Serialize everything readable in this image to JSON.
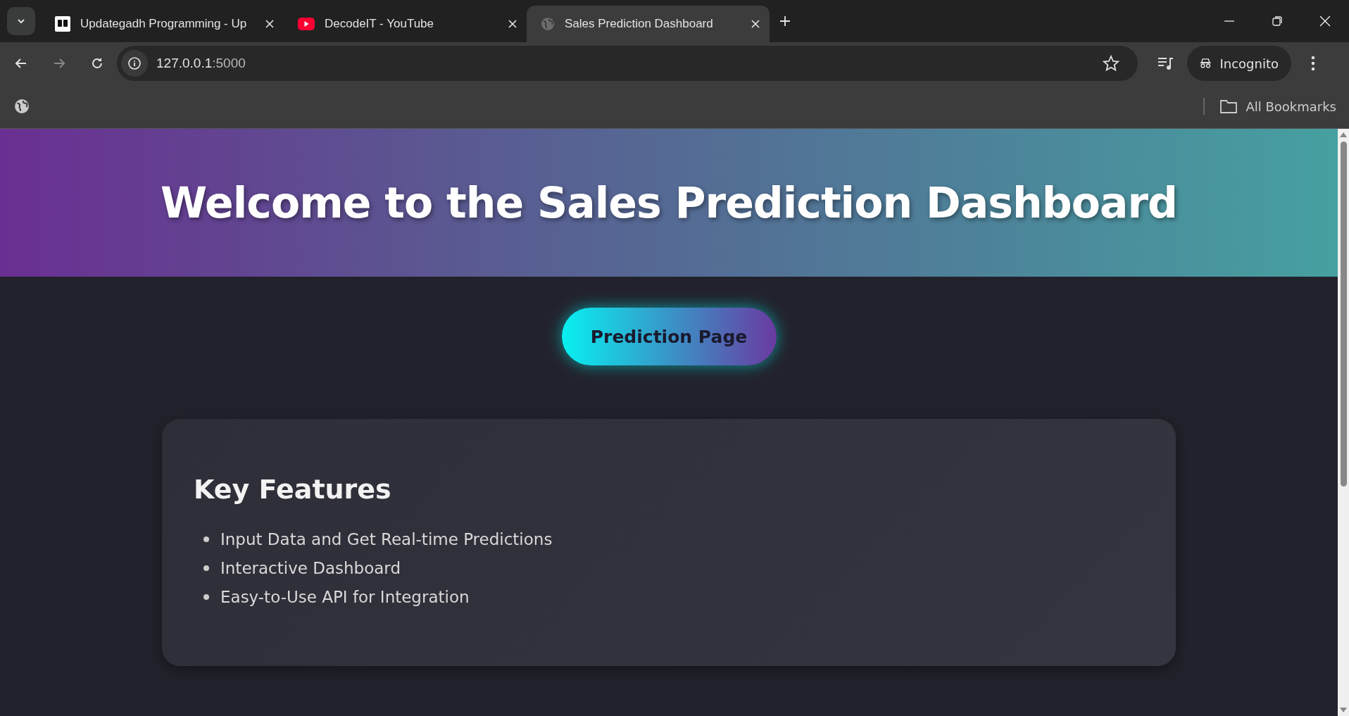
{
  "browser": {
    "tabs": [
      {
        "title": "Updategadh Programming - Up",
        "kind": "ug",
        "selected": false
      },
      {
        "title": "DecodeIT - YouTube",
        "kind": "youtube",
        "selected": false
      },
      {
        "title": "Sales Prediction Dashboard",
        "kind": "globe",
        "selected": true
      }
    ],
    "address": {
      "host": "127.0.0.1",
      "port": ":5000"
    },
    "profile": "Incognito",
    "bookmarks": "All Bookmarks"
  },
  "page": {
    "header_title": "Welcome to the Sales Prediction Dashboard",
    "button": "Prediction Page",
    "features": {
      "title": "Key Features",
      "items": [
        "Input Data and Get Real-time Predictions",
        "Interactive Dashboard",
        "Easy-to-Use API for Integration"
      ]
    }
  }
}
